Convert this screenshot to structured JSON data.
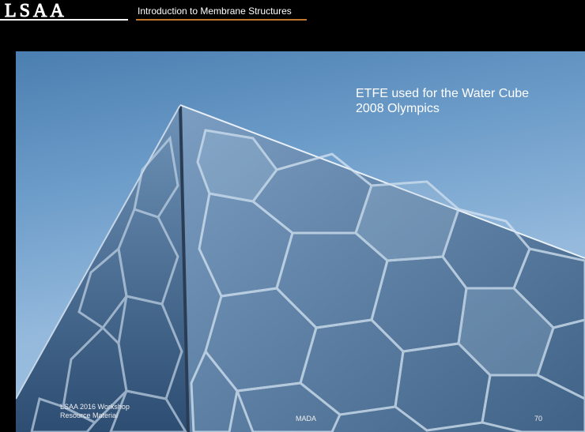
{
  "header": {
    "logo_text": "LSAA",
    "title": "Introduction to Membrane Structures"
  },
  "slide": {
    "caption_line1": "ETFE used for the Water Cube",
    "caption_line2": "2008 Olympics"
  },
  "footer": {
    "left_line1": "LSAA 2016 Workshop",
    "left_line2": "Resource Material",
    "center": "MADA",
    "page_number": "70"
  }
}
